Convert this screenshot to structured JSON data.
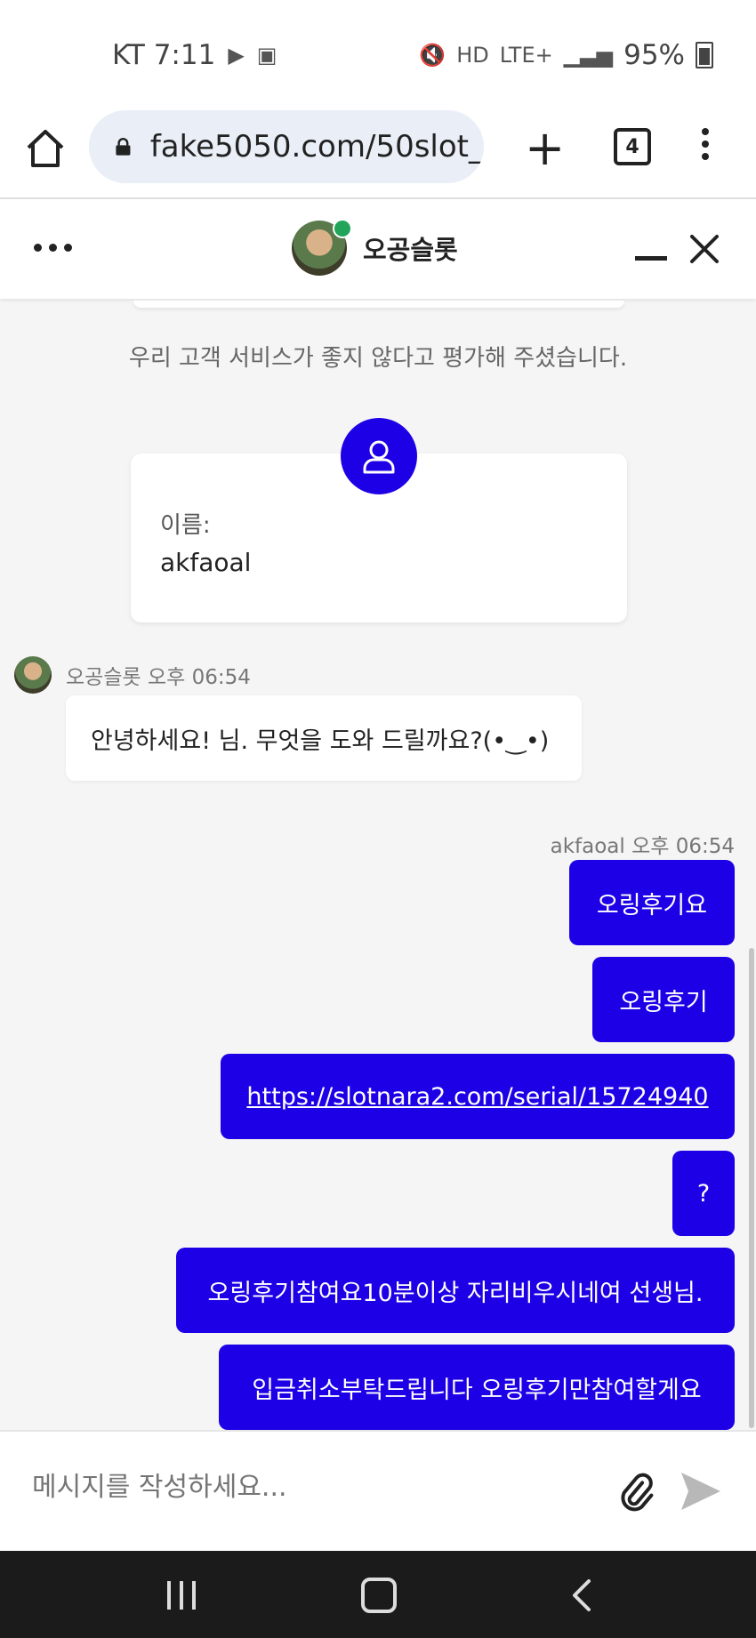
{
  "status": {
    "carrier_time": "KT 7:11",
    "network": "LTE+",
    "battery": "95%",
    "hd": "HD"
  },
  "browser": {
    "url": "fake5050.com/50slot_",
    "tab_count": "4"
  },
  "header": {
    "title": "오공슬롯"
  },
  "chat": {
    "system_note": "우리 고객 서비스가 좋지 않다고 평가해 주셨습니다.",
    "info_label": "이름:",
    "info_value": "akfaoal",
    "agent_meta": "오공슬롯 오후 06:54",
    "agent_message": "안녕하세요! 님. 무엇을 도와 드릴까요?(•‿•)",
    "user_meta": "akfaoal 오후 06:54",
    "user_messages": [
      "오링후기요",
      "오링후기",
      "https://slotnara2.com/serial/15724940",
      "?",
      "오링후기참여요10분이상 자리비우시네여 선생님.",
      "입금취소부탁드립니다 오링후기만참여할게요"
    ]
  },
  "input": {
    "placeholder": "메시지를 작성하세요..."
  },
  "colors": {
    "accent": "#1e00e6",
    "online": "#22a55a"
  }
}
